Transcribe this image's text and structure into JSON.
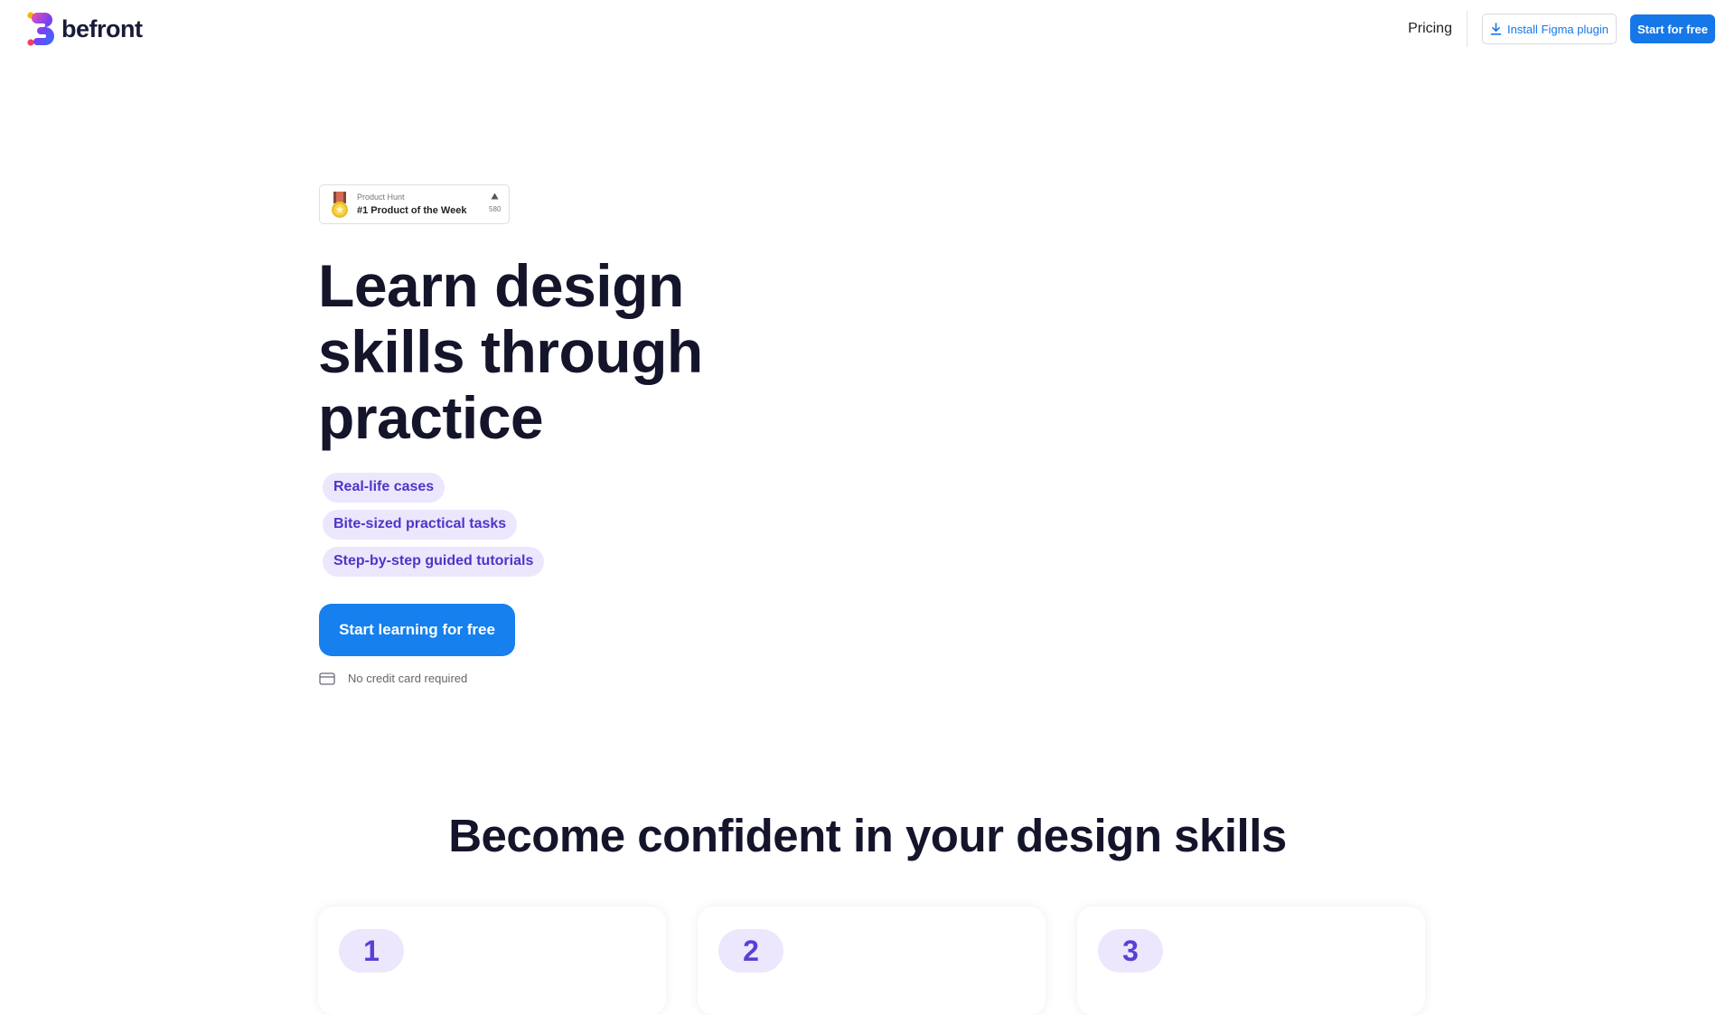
{
  "header": {
    "logo_text": "befront",
    "nav": {
      "pricing_label": "Pricing",
      "plugin_label": "Install Figma plugin",
      "start_label": "Start for free"
    }
  },
  "product_hunt": {
    "subtitle": "Product Hunt",
    "title": "#1 Product of the Week",
    "upvotes": "580"
  },
  "hero": {
    "title_lines": [
      "Learn design",
      "skills through",
      "practice"
    ],
    "features": [
      "Real-life cases",
      "Bite-sized practical tasks",
      "Step-by-step guided tutorials"
    ],
    "cta_label": "Start learning for free",
    "note": "No credit card required"
  },
  "section": {
    "title": "Become confident in your design skills",
    "steps": [
      "1",
      "2",
      "3"
    ]
  },
  "colors": {
    "primary": "#1580ee",
    "chip_bg": "#ece7fd",
    "chip_text": "#5233c9",
    "heading": "#14142b"
  },
  "icons": {
    "download": "download-icon",
    "medal": "medal-icon",
    "upvote": "triangle-up-icon",
    "card": "credit-card-icon"
  }
}
